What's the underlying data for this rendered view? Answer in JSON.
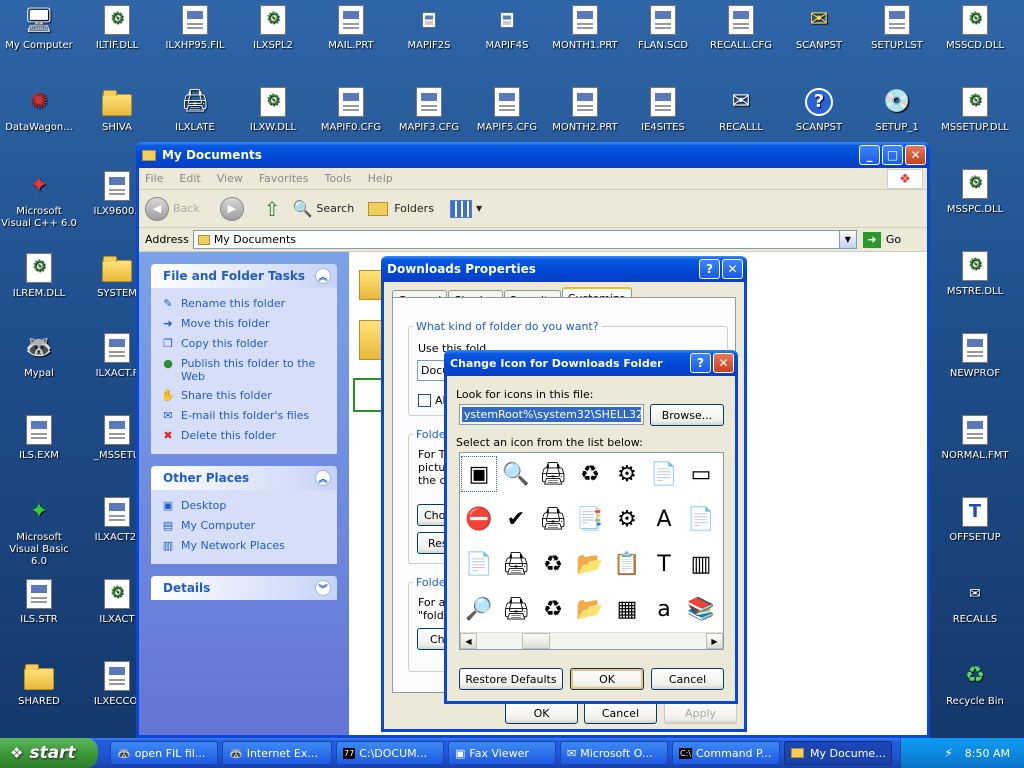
{
  "desktop_icons": [
    {
      "label": "My Computer",
      "glyph": "🖥"
    },
    {
      "label": "ILTIF.DLL",
      "glyph": "gear"
    },
    {
      "label": "ILXHP95.FIL",
      "glyph": "doc"
    },
    {
      "label": "ILXSPL2",
      "glyph": "gear"
    },
    {
      "label": "MAIL.PRT",
      "glyph": "doc"
    },
    {
      "label": "MAPIF2S",
      "glyph": "doc"
    },
    {
      "label": "MAPIF4S",
      "glyph": "doc"
    },
    {
      "label": "MONTH1.PRT",
      "glyph": "doc"
    },
    {
      "label": "FLAN.SCD",
      "glyph": "doc"
    },
    {
      "label": "RECALL.CFG",
      "glyph": "doc"
    },
    {
      "label": "SCANPST",
      "glyph": "✉"
    },
    {
      "label": "SETUP.LST",
      "glyph": "doc"
    },
    {
      "label": "MSSCD.DLL",
      "glyph": "gear"
    },
    {
      "label": "DataWagon...",
      "glyph": "✺"
    },
    {
      "label": "SHIVA",
      "glyph": "folder"
    },
    {
      "label": "ILXLATE",
      "glyph": "🖨"
    },
    {
      "label": "ILXW.DLL",
      "glyph": "gear"
    },
    {
      "label": "MAPIF0.CFG",
      "glyph": "doc"
    },
    {
      "label": "MAPIF3.CFG",
      "glyph": "doc"
    },
    {
      "label": "MAPIF5.CFG",
      "glyph": "doc"
    },
    {
      "label": "MONTH2.PRT",
      "glyph": "doc"
    },
    {
      "label": "IE4SITES",
      "glyph": "doc"
    },
    {
      "label": "RECALLL",
      "glyph": "✉"
    },
    {
      "label": "SCANPST",
      "glyph": "?"
    },
    {
      "label": "SETUP_1",
      "glyph": "💿"
    },
    {
      "label": "MSSETUP.DLL",
      "glyph": "gear"
    },
    {
      "label": "Microsoft Visual C++ 6.0",
      "glyph": "✦"
    },
    {
      "label": "ILX9600.I",
      "glyph": "doc"
    },
    {
      "label": "MSSPC.DLL",
      "glyph": "gear"
    },
    {
      "label": "ILREM.DLL",
      "glyph": "gear"
    },
    {
      "label": "SYSTEM",
      "glyph": "folder"
    },
    {
      "label": "MSTRE.DLL",
      "glyph": "gear"
    },
    {
      "label": "Mypal",
      "glyph": "🦝"
    },
    {
      "label": "ILXACT.F",
      "glyph": "doc"
    },
    {
      "label": "NEWPROF",
      "glyph": "doc"
    },
    {
      "label": "ILS.EXM",
      "glyph": "doc"
    },
    {
      "label": "_MSSETU",
      "glyph": "doc"
    },
    {
      "label": "NORMAL.FMT",
      "glyph": "doc"
    },
    {
      "label": "Microsoft Visual Basic 6.0",
      "glyph": "✦"
    },
    {
      "label": "ILXACT2.",
      "glyph": "doc"
    },
    {
      "label": "OFFSETUP",
      "glyph": "T"
    },
    {
      "label": "ILS.STR",
      "glyph": "doc"
    },
    {
      "label": "ILXACT",
      "glyph": "gear"
    },
    {
      "label": "RECALLS",
      "glyph": "✉"
    },
    {
      "label": "SHARED",
      "glyph": "folder"
    },
    {
      "label": "ILXECCO.",
      "glyph": "doc"
    },
    {
      "label": "Recycle Bin",
      "glyph": "♻"
    }
  ],
  "explorer": {
    "title": "My Documents",
    "menu": [
      "File",
      "Edit",
      "View",
      "Favorites",
      "Tools",
      "Help"
    ],
    "back_label": "Back",
    "search_label": "Search",
    "folders_label": "Folders",
    "address_label": "Address",
    "address_value": "My Documents",
    "go_label": "Go",
    "tasks_title": "File and Folder Tasks",
    "tasks": [
      {
        "label": "Rename this folder",
        "icon": "✎"
      },
      {
        "label": "Move this folder",
        "icon": "➜"
      },
      {
        "label": "Copy this folder",
        "icon": "❐"
      },
      {
        "label": "Publish this folder to the Web",
        "icon": "🌐"
      },
      {
        "label": "Share this folder",
        "icon": "✋"
      },
      {
        "label": "E-mail this folder's files",
        "icon": "✉"
      },
      {
        "label": "Delete this folder",
        "icon": "✖"
      }
    ],
    "other_title": "Other Places",
    "other": [
      {
        "label": "Desktop",
        "icon": "▣"
      },
      {
        "label": "My Computer",
        "icon": "▤"
      },
      {
        "label": "My Network Places",
        "icon": "▥"
      }
    ],
    "details_title": "Details"
  },
  "props": {
    "title": "Downloads Properties",
    "tabs": [
      "General",
      "Sharing",
      "Security",
      "Customize"
    ],
    "active_tab": "Customize",
    "q1": "What kind of folder do you want?",
    "use_this": "Use this folder type as a template:",
    "template_value": "Docu",
    "also_label": "Als",
    "folder_pictures_group": "Folder",
    "for_text": "For Th",
    "picture_text": "picture",
    "the_co": "the co",
    "choose_btn": "Choo",
    "restore_btn": "Res",
    "folder_icons_group": "Folder",
    "for_all": "For all",
    "folder_q": "\"folder",
    "change_btn": "Cha",
    "ok": "OK",
    "cancel": "Cancel",
    "apply": "Apply"
  },
  "change_icon": {
    "title": "Change Icon for Downloads Folder",
    "look_label": "Look for icons in this file:",
    "file_value": "ystemRoot%\\system32\\SHELL32.dll",
    "browse": "Browse...",
    "select_label": "Select an icon from the list below:",
    "icons": [
      "▣",
      "🔍",
      "🖨",
      "♻",
      "⚙",
      "📄",
      "▭",
      "⛔",
      "✔",
      "🖨",
      "📑",
      "⚙",
      "A",
      "📄",
      "📄",
      "🖨",
      "♻",
      "📂",
      "📋",
      "T",
      "▥",
      "🔎",
      "🖨",
      "♻",
      "📂",
      "▦",
      "a",
      "📚"
    ],
    "restore_defaults": "Restore Defaults",
    "ok": "OK",
    "cancel": "Cancel"
  },
  "taskbar": {
    "start": "start",
    "items": [
      "open FIL fil...",
      "Internet Ex...",
      "C:\\DOCUM...",
      "Fax Viewer",
      "Microsoft O...",
      "Command P...",
      "My Docume..."
    ],
    "clock": "8:50 AM"
  }
}
